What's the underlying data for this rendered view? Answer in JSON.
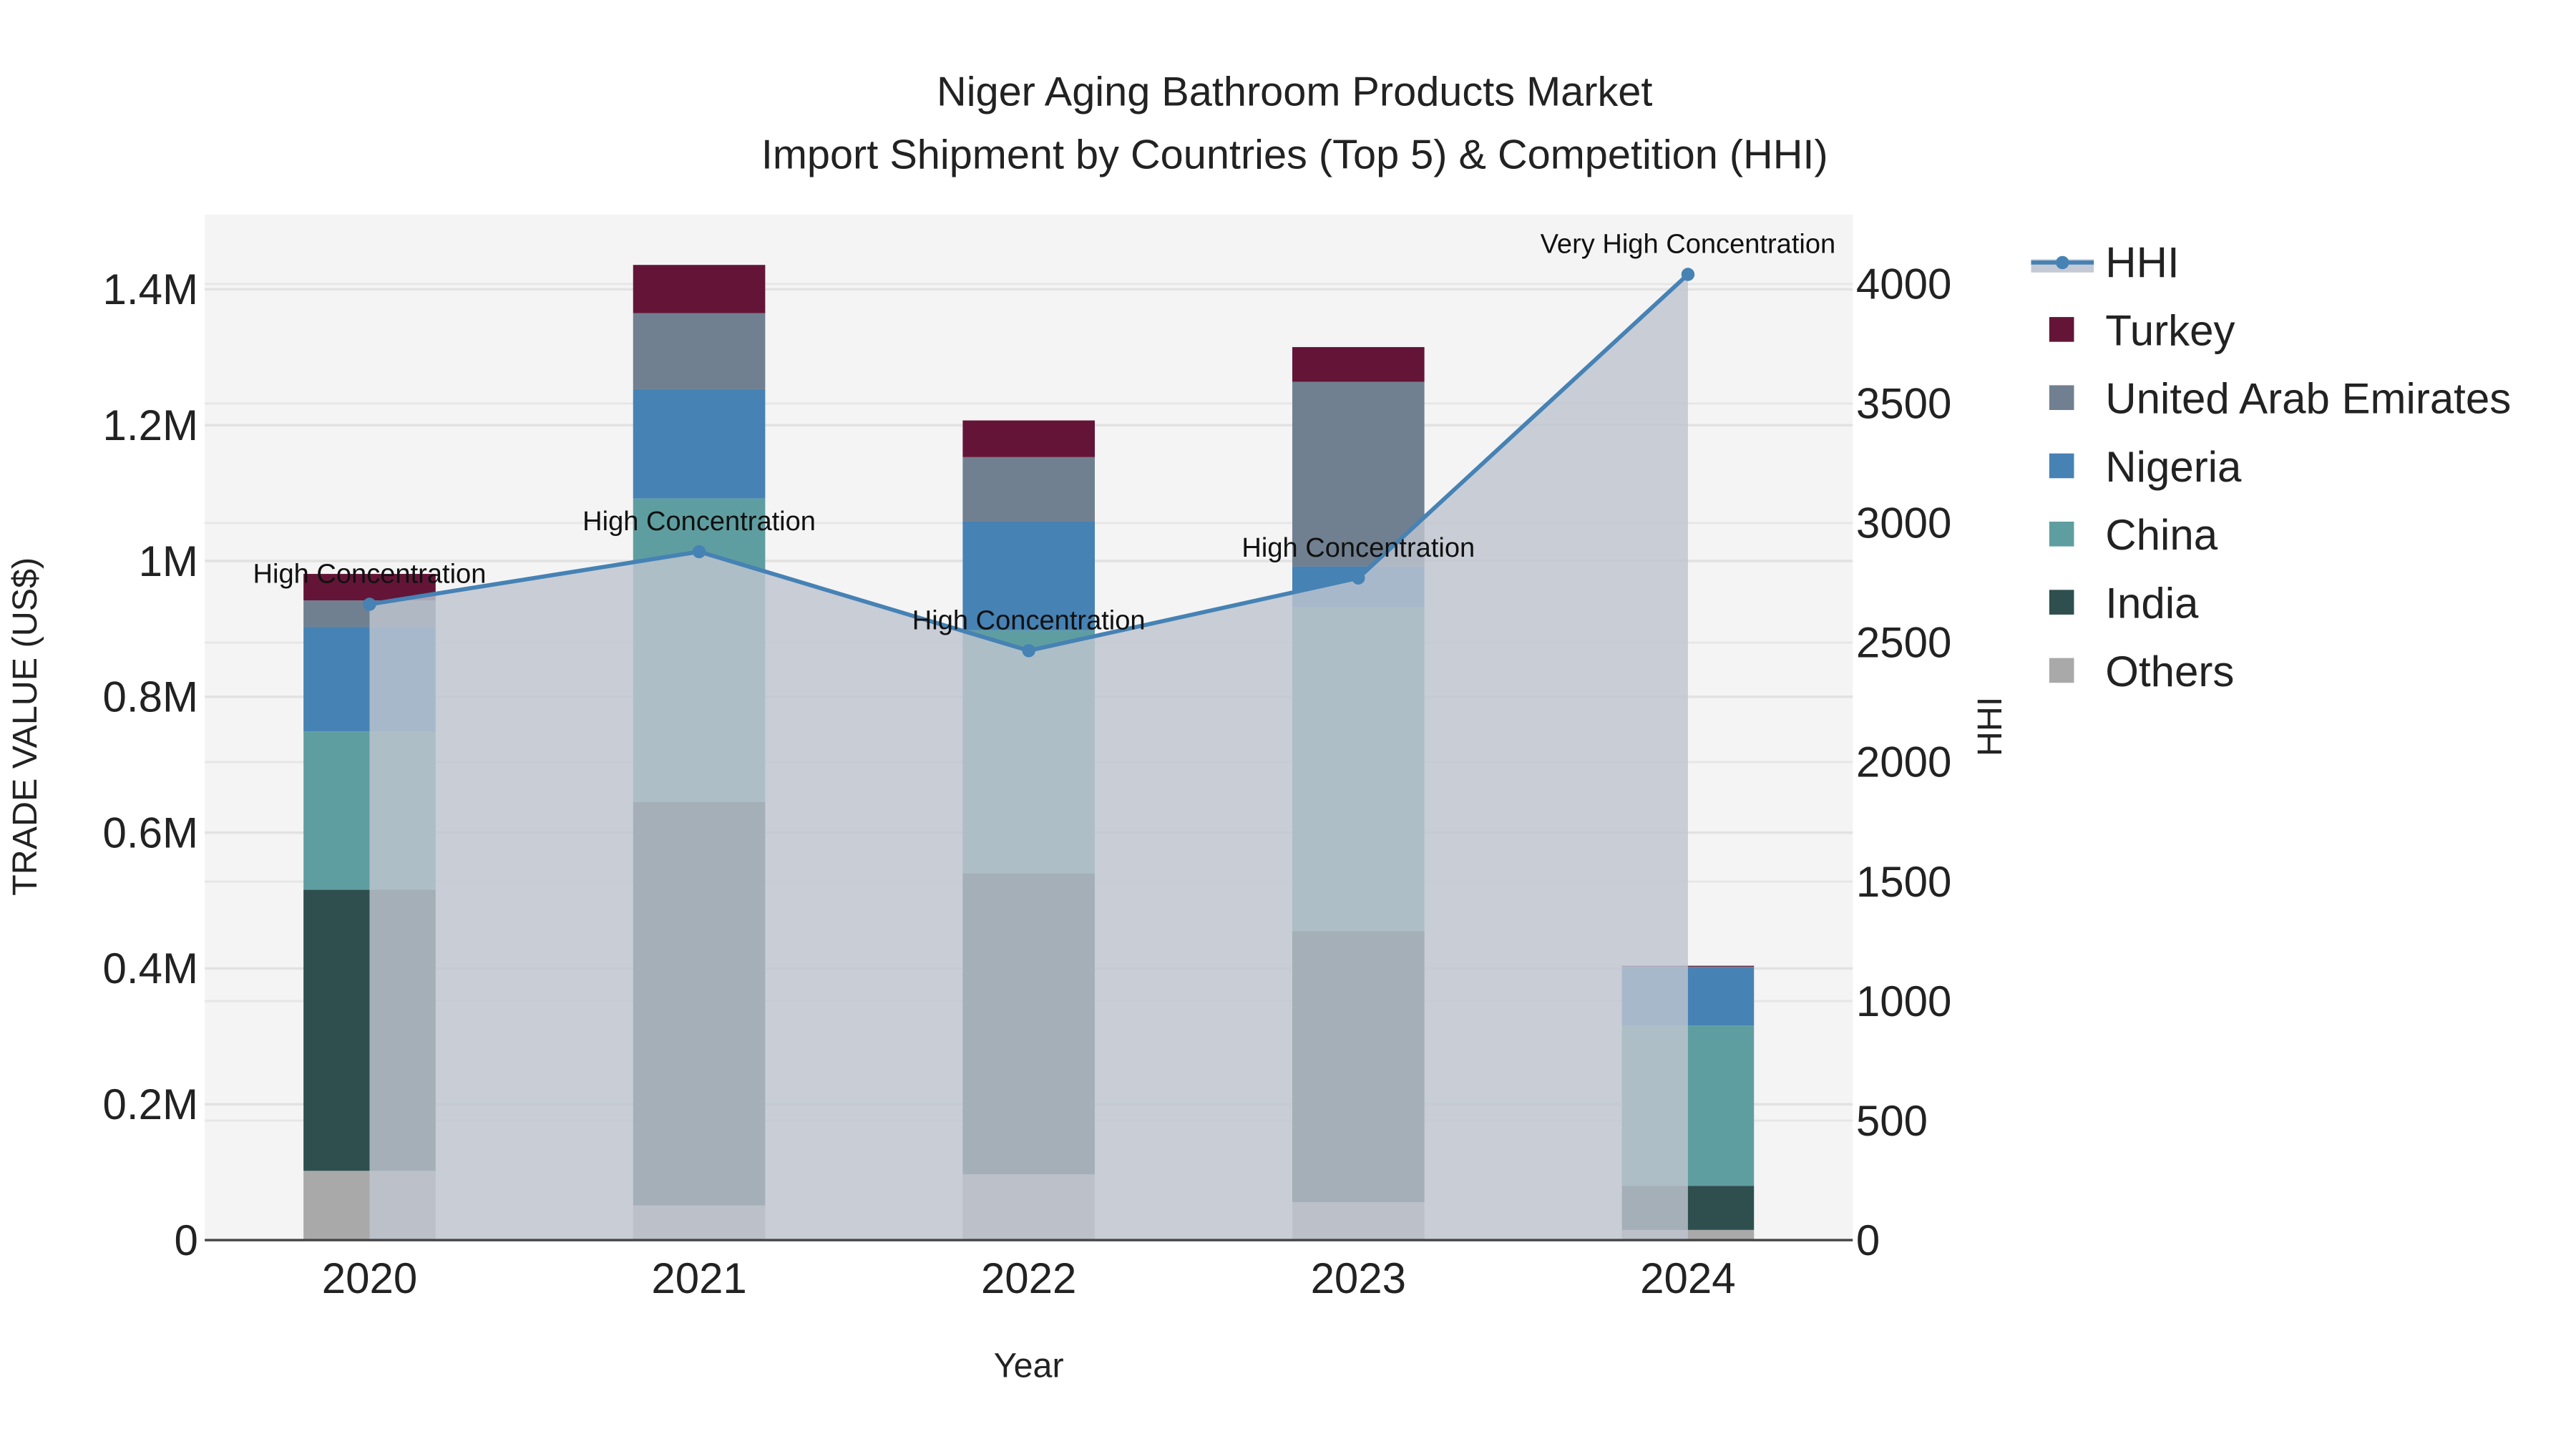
{
  "chart_data": {
    "type": "bar",
    "title_line1": "Niger Aging Bathroom Products Market",
    "title_line2": "Import Shipment by Countries (Top 5) & Competition (HHI)",
    "xlabel": "Year",
    "ylabel": "TRADE VALUE (US$)",
    "y2label": "HHI",
    "categories": [
      "2020",
      "2021",
      "2022",
      "2023",
      "2024"
    ],
    "ylim": [
      0,
      1.51
    ],
    "y_unit": "millions US$",
    "yticks": [
      0,
      0.2,
      0.4,
      0.6,
      0.8,
      1,
      1.2,
      1.4
    ],
    "ytick_labels": [
      "0",
      "0.2M",
      "0.4M",
      "0.6M",
      "0.8M",
      "1M",
      "1.2M",
      "1.4M"
    ],
    "y2lim": [
      0,
      4290
    ],
    "y2ticks": [
      0,
      500,
      1000,
      1500,
      2000,
      2500,
      3000,
      3500,
      4000
    ],
    "y2tick_labels": [
      "0",
      "500",
      "1000",
      "1500",
      "2000",
      "2500",
      "3000",
      "3500",
      "4000"
    ],
    "grid": true,
    "legend_position": "right",
    "series": [
      {
        "name": "Others",
        "color": "#A9A9A9",
        "values": [
          0.102,
          0.051,
          0.097,
          0.056,
          0.015
        ]
      },
      {
        "name": "India",
        "color": "#2F4F4F",
        "values": [
          0.414,
          0.594,
          0.443,
          0.399,
          0.065
        ]
      },
      {
        "name": "China",
        "color": "#5F9EA0",
        "values": [
          0.233,
          0.447,
          0.358,
          0.477,
          0.236
        ]
      },
      {
        "name": "Nigeria",
        "color": "#4682B4",
        "values": [
          0.154,
          0.161,
          0.16,
          0.06,
          0.085
        ]
      },
      {
        "name": "United Arab Emirates",
        "color": "#708090",
        "values": [
          0.039,
          0.112,
          0.095,
          0.272,
          0.002
        ]
      },
      {
        "name": "Turkey",
        "color": "#641537",
        "values": [
          0.039,
          0.071,
          0.054,
          0.051,
          0.001
        ]
      }
    ],
    "hhi": {
      "name": "HHI",
      "color": "#4682B4",
      "values": [
        2660,
        2880,
        2466,
        2770,
        4040
      ],
      "annotations": [
        "High Concentration",
        "High Concentration",
        "High Concentration",
        "High Concentration",
        "Very High Concentration"
      ]
    }
  }
}
